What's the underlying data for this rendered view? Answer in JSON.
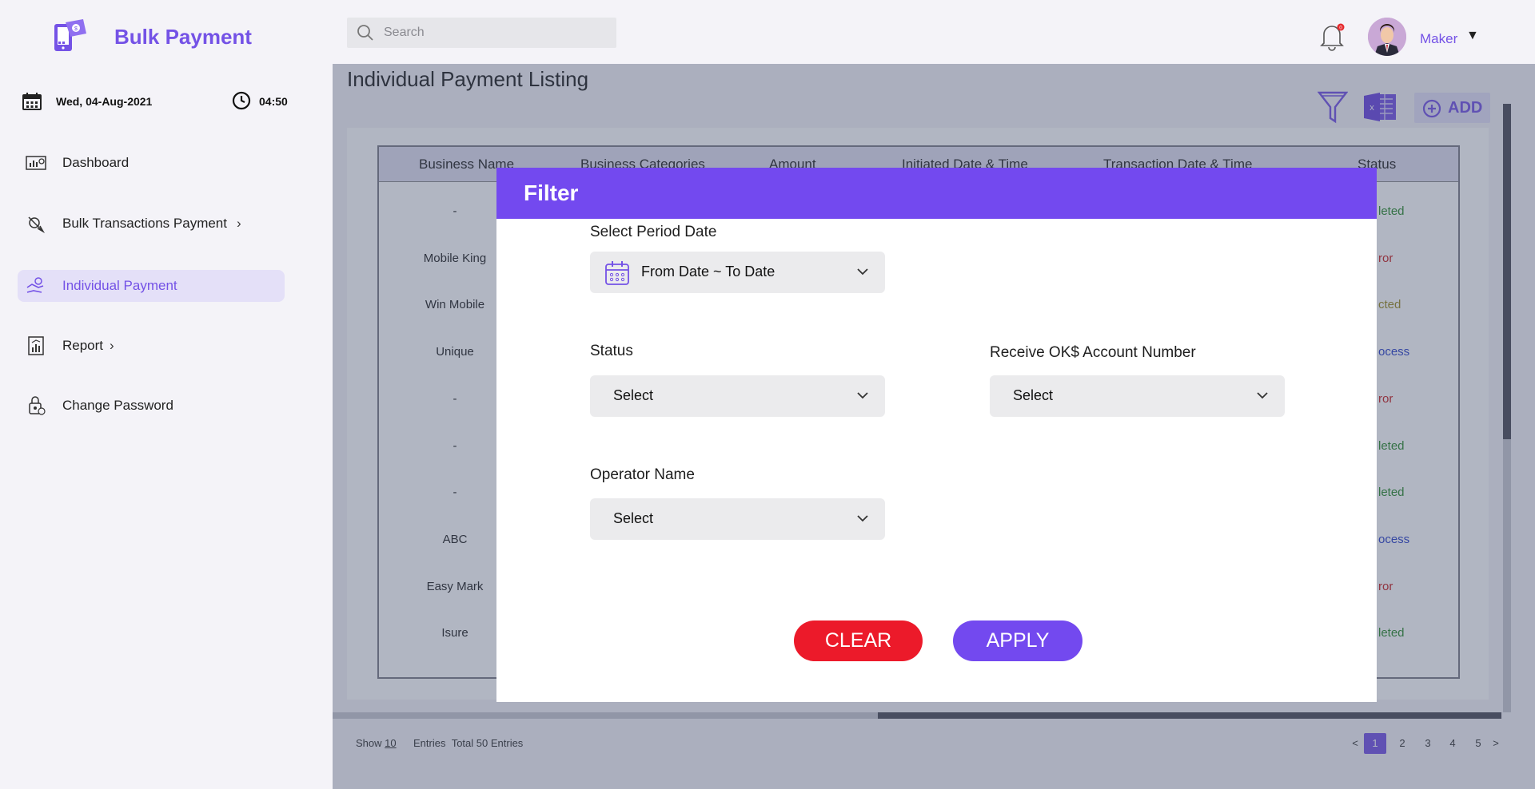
{
  "app": {
    "brand": "Bulk Payment"
  },
  "datebar": {
    "date": "Wed, 04-Aug-2021",
    "time": "04:50"
  },
  "sidebar": {
    "items": [
      {
        "label": "Dashboard",
        "icon": "dashboard-icon"
      },
      {
        "label": "Bulk Transactions Payment",
        "icon": "bulk-transactions-icon",
        "has_chevron": true
      },
      {
        "label": "Individual Payment",
        "icon": "individual-payment-icon",
        "active": true
      },
      {
        "label": "Report",
        "icon": "report-icon",
        "has_chevron": true
      },
      {
        "label": "Change Password",
        "icon": "change-password-icon"
      }
    ]
  },
  "header": {
    "search_placeholder": "Search",
    "notification_count": "0",
    "user_name": "Maker"
  },
  "page": {
    "title": "Individual Payment Listing",
    "add_label": "ADD"
  },
  "table": {
    "headers": [
      "Business Name",
      "Business Categories",
      "Amount",
      "Initiated Date & Time",
      "Transaction Date & Time",
      "Status"
    ],
    "business_names": [
      "-",
      "Mobile King",
      "Win Mobile",
      "Unique",
      "-",
      "-",
      "-",
      "ABC",
      "Easy Mark",
      "Isure"
    ],
    "status_partials": [
      "leted",
      "ror",
      "cted",
      "ocess",
      "ror",
      "leted",
      "leted",
      "ocess",
      "ror",
      "leted"
    ],
    "status_colors": [
      "#2a8a2a",
      "#c82020",
      "#9a8a20",
      "#2a40c8",
      "#c82020",
      "#2a8a2a",
      "#2a8a2a",
      "#2a40c8",
      "#c82020",
      "#2a8a2a"
    ]
  },
  "footer": {
    "show_label": "Show",
    "show_count": "10",
    "entries_label": "Entries",
    "total_label": "Total 50 Entries",
    "prev": "<",
    "next": ">",
    "pages": [
      "1",
      "2",
      "3",
      "4",
      "5"
    ],
    "current_page": "1"
  },
  "modal": {
    "title": "Filter",
    "period_label": "Select Period Date",
    "period_value": "From Date ~ To Date",
    "status_label": "Status",
    "status_value": "Select",
    "account_label": "Receive OK$ Account Number",
    "account_value": "Select",
    "operator_label": "Operator Name",
    "operator_value": "Select",
    "clear_label": "CLEAR",
    "apply_label": "APPLY"
  },
  "colors": {
    "accent": "#7452e6",
    "modal_header": "#7349ef",
    "clear": "#ec1a2a"
  }
}
